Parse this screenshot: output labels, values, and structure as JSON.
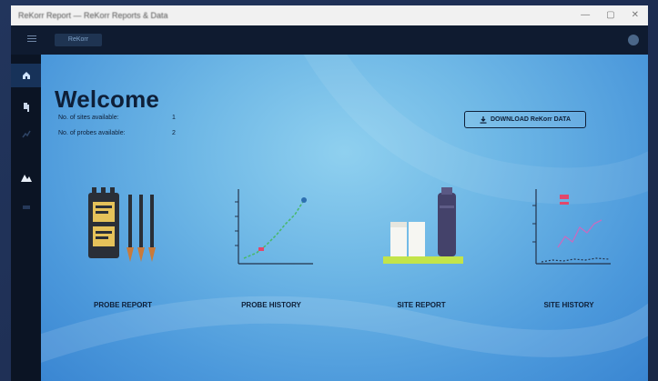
{
  "window": {
    "title": "ReKorr Report — ReKorr Reports & Data"
  },
  "appbar": {
    "tab_label": "ReKorr"
  },
  "welcome": {
    "heading": "Welcome"
  },
  "stats": [
    {
      "label": "No. of sites available:",
      "value": "1"
    },
    {
      "label": "No. of probes available:",
      "value": "2"
    }
  ],
  "download": {
    "label": "DOWNLOAD ReKorr DATA"
  },
  "cards": [
    {
      "label": "PROBE REPORT"
    },
    {
      "label": "PROBE HISTORY"
    },
    {
      "label": "SITE REPORT"
    },
    {
      "label": "SITE HISTORY"
    }
  ],
  "colors": {
    "main_bg": "#6fb8e6",
    "text": "#0e1f38",
    "nav_bg": "#0b1424",
    "appbar_bg": "#0f1b30"
  }
}
